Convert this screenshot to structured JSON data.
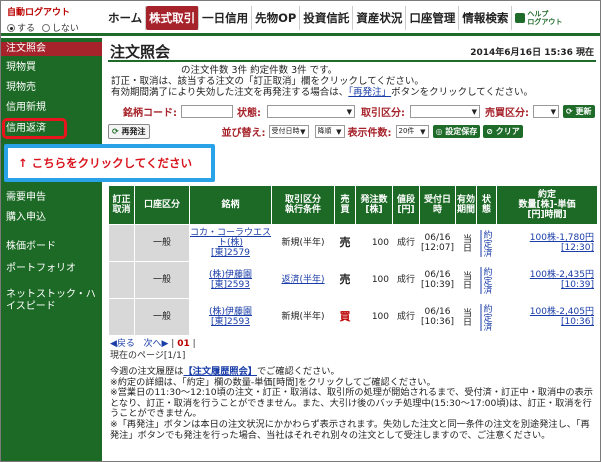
{
  "header": {
    "autologout_title": "自動ログアウト",
    "autologout_on": "する",
    "autologout_off": "しない",
    "nav": [
      "ホーム",
      "株式取引",
      "一日信用",
      "先物OP",
      "投資信託",
      "資産状況",
      "口座管理",
      "情報検索"
    ],
    "help": "ヘルプ\nログアウト"
  },
  "sidebar": {
    "items": [
      "注文照会",
      "現物買",
      "現物売",
      "信用新規",
      "信用返済",
      "需要申告",
      "購入申込",
      "株価ボード",
      "ポートフォリオ",
      "ネットストック・ハイスピード"
    ]
  },
  "callout": {
    "text": "↑ こちらをクリックしてください"
  },
  "main": {
    "title": "注文照会",
    "date": "2014年6月16日 15:36 現在",
    "count_line": "の注文件数 3件 約定件数 3件 です。",
    "info1": "訂正・取消は、該当する注文の「訂正取消」欄をクリックしてください。",
    "info2a": "有効期間満了により失効した注文を再発注する場合は、",
    "info2link": "「再発注」",
    "info2b": "ボタンをクリックしてください。",
    "filter": {
      "code_label": "銘柄コード:",
      "status_label": "状態:",
      "torihiki_label": "取引区分:",
      "baibai_label": "売買区分:",
      "update_button": "更新",
      "reorder_button": "再発注",
      "sort_label": "並び替え:",
      "sort_value": "受付日時",
      "order_value": "降順",
      "display_label": "表示件数:",
      "display_value": "20件",
      "save_button": "設定保存",
      "clear_button": "クリア"
    }
  },
  "table": {
    "headers": [
      "訂正\n取消",
      "口座区分",
      "銘柄",
      "取引区分\n執行条件",
      "売\n買",
      "発注数\n[株]",
      "値段\n[円]",
      "受付日\n時",
      "有効\n期間",
      "状\n態",
      "約定\n数量[株]-単価\n[円]時間]"
    ],
    "rows": [
      {
        "account": "一般",
        "name": "コカ・コーラウエスト(株)",
        "code": "[東]2579",
        "type": "新規(半年)",
        "side": "売",
        "qty": "100",
        "price": "成行",
        "date": "06/16",
        "time": "[12:07]",
        "period": "当日",
        "status": "約定済",
        "exec": "100株-1,780円",
        "exec_time": "[12:30]"
      },
      {
        "account": "一般",
        "name": "(株)伊藤園",
        "code": "[東]2593",
        "type": "返済(半年)",
        "side": "売",
        "qty": "100",
        "price": "成行",
        "date": "06/16",
        "time": "[10:39]",
        "period": "当日",
        "status": "約定済",
        "exec": "100株-2,435円",
        "exec_time": "[10:39]"
      },
      {
        "account": "一般",
        "name": "(株)伊藤園",
        "code": "[東]2593",
        "type": "新規(半年)",
        "side": "買",
        "qty": "100",
        "price": "成行",
        "date": "06/16",
        "time": "[10:36]",
        "period": "当日",
        "status": "約定済",
        "exec": "100株-2,405円",
        "exec_time": "[10:36]"
      }
    ]
  },
  "pager": {
    "prev": "◀戻る",
    "next": "次へ▶",
    "page": "01",
    "current": "現在のページ[1/1]"
  },
  "notes": {
    "history_a": "今週の注文履歴は",
    "history_link": "【注文履歴照会】",
    "history_b": "でご確認ください。",
    "n1": "※約定の詳細は、「約定」欄の数量-単価[時間]をクリックしてご確認ください。",
    "n2": "※営業日の11:30〜12:10頃の注文・訂正・取消は、取引所の処理が開始されるまで、受付済・訂正中・取消中の表示となり、訂正・取消を行うことができません。また、大引け後のバッチ処理中(15:30〜17:00頃)は、訂正・取消を行うことができません。",
    "n3": "※「再発注」ボタンは本日の注文状況にかかわらず表示されます。失効した注文と同一条件の注文を別途発注し、「再発注」ボタンでも発注を行った場合、当社はそれぞれ別々の注文として受注しますので、ご注意ください。"
  }
}
